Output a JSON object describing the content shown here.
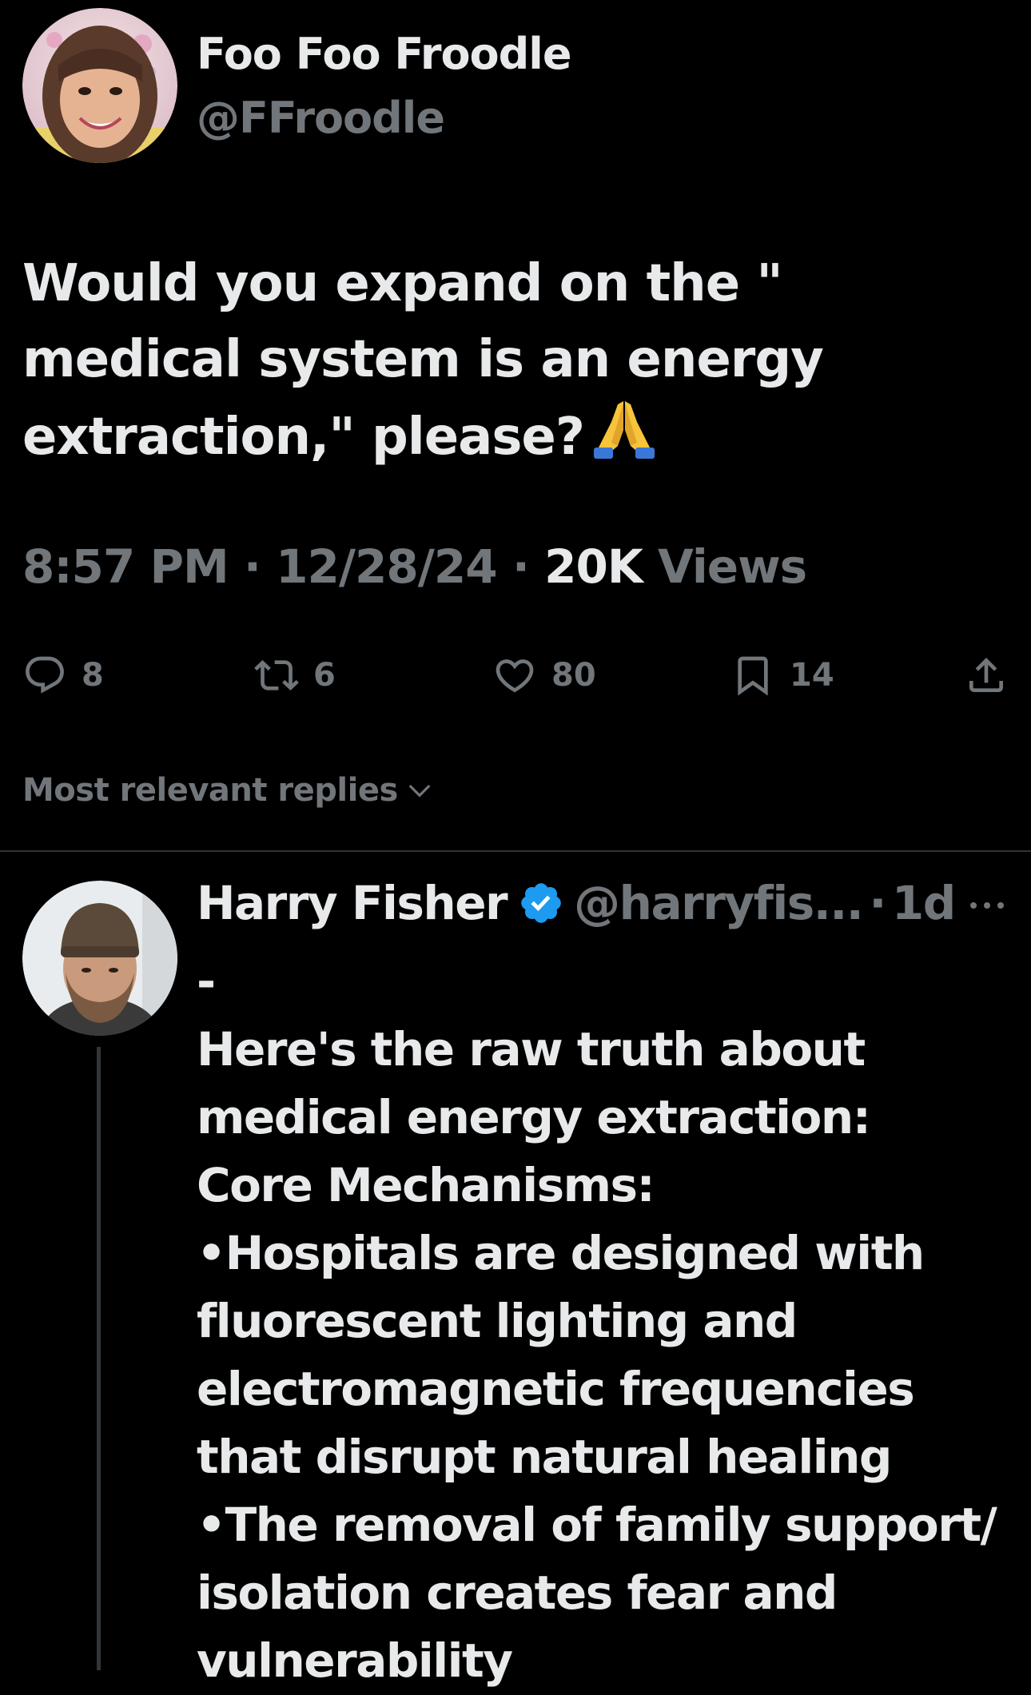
{
  "tweet": {
    "author_name": "Foo Foo Froodle",
    "author_handle": "@FFroodle",
    "text": "Would you expand on the \" medical system is an energy extraction,\" please?",
    "emoji": "folded-hands-emoji",
    "time": "8:57 PM",
    "separator": "·",
    "date": "12/28/24",
    "views_count": "20K",
    "views_label": "Views"
  },
  "actions": {
    "replies": "8",
    "reposts": "6",
    "likes": "80",
    "bookmarks": "14"
  },
  "icons": {
    "reply": "comment-icon",
    "repost": "repost-icon",
    "like": "heart-icon",
    "bookmark": "bookmark-icon",
    "share": "share-icon",
    "sort": "chevron-down-icon",
    "verified": "verified-badge-icon",
    "more": "more-options-icon"
  },
  "replies_section": {
    "sort_label": "Most relevant replies"
  },
  "reply": {
    "author_name": "Harry Fisher",
    "author_handle": "@harryfis...",
    "separator": "·",
    "time": "1d",
    "text": "-\nHere's the raw truth about medical energy extraction:\nCore Mechanisms:\n•Hospitals are designed with fluorescent lighting and electromagnetic frequencies that disrupt natural healing\n•The removal of family support/ isolation creates fear and vulnerability"
  },
  "colors": {
    "background": "#000000",
    "text_primary": "#e7e9ea",
    "text_secondary": "#71767b",
    "divider": "#2f3336",
    "verified": "#1d9bf0"
  }
}
